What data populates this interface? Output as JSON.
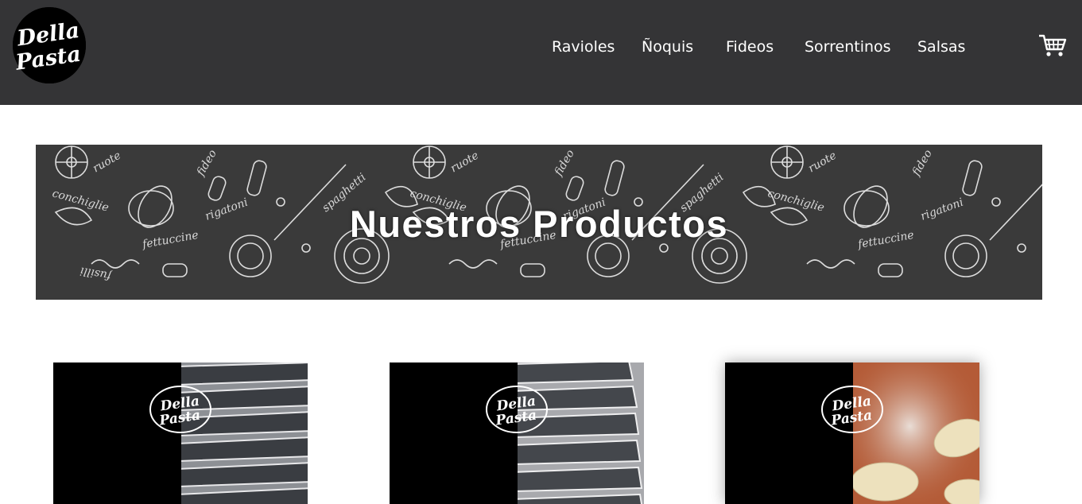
{
  "brand": {
    "name_line1": "Della",
    "name_line2": "Pasta",
    "logo_icon": "della-pasta-logo"
  },
  "nav": {
    "items": [
      {
        "label": "Ravioles"
      },
      {
        "label": "Ñoquis"
      },
      {
        "label": "Fideos"
      },
      {
        "label": "Sorrentinos"
      },
      {
        "label": "Salsas"
      }
    ],
    "cart_icon": "shopping-cart-icon"
  },
  "banner": {
    "title": "Nuestros Productos",
    "pattern_words": [
      "ruote",
      "fideo",
      "conchiglie",
      "spaghetti",
      "rigatoni",
      "fettuccine",
      "fusilli"
    ]
  },
  "products": [
    {
      "logo_line1": "Della",
      "logo_line2": "Pasta",
      "photo": "packaged-pasta-photo"
    },
    {
      "logo_line1": "Della",
      "logo_line2": "Pasta",
      "photo": "packaged-pasta-photo"
    },
    {
      "logo_line1": "Della",
      "logo_line2": "Pasta",
      "photo": "gnocchi-photo"
    }
  ],
  "colors": {
    "navbar": "#343436",
    "banner": "#3a3a3a",
    "text_light": "#ffffff"
  }
}
